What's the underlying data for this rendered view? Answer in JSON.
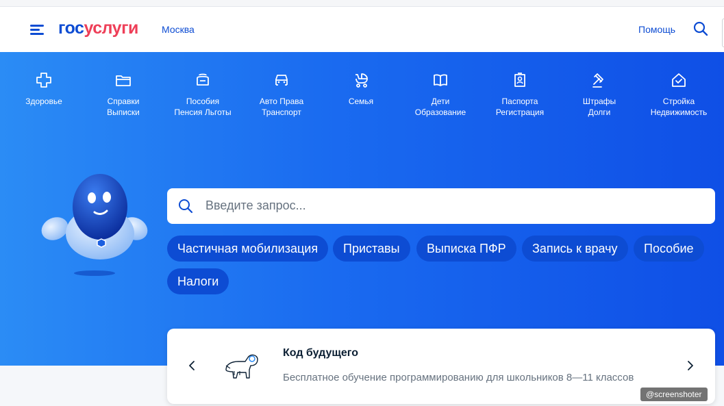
{
  "header": {
    "logo_part1": "гос",
    "logo_part2": "услуги",
    "city": "Москва",
    "help": "Помощь"
  },
  "categories": [
    {
      "line1": "Здоровье",
      "line2": "",
      "icon": "health-cross-icon"
    },
    {
      "line1": "Справки",
      "line2": "Выписки",
      "icon": "folder-icon"
    },
    {
      "line1": "Пособия",
      "line2": "Пенсия Льготы",
      "icon": "wallet-icon"
    },
    {
      "line1": "Авто Права",
      "line2": "Транспорт",
      "icon": "car-icon"
    },
    {
      "line1": "Семья",
      "line2": "",
      "icon": "stroller-icon"
    },
    {
      "line1": "Дети",
      "line2": "Образование",
      "icon": "book-icon"
    },
    {
      "line1": "Паспорта",
      "line2": "Регистрация",
      "icon": "passport-icon"
    },
    {
      "line1": "Штрафы",
      "line2": "Долги",
      "icon": "gavel-icon"
    },
    {
      "line1": "Стройка",
      "line2": "Недвижимость",
      "icon": "house-icon"
    }
  ],
  "search": {
    "placeholder": "Введите запрос..."
  },
  "chips": [
    "Частичная мобилизация",
    "Приставы",
    "Выписка ПФР",
    "Запись к врачу",
    "Пособие",
    "Налоги"
  ],
  "promo": {
    "title": "Код будущего",
    "description": "Бесплатное обучение программированию для школьников 8—11 классов"
  },
  "watermark": "@screenshoter",
  "colors": {
    "brand_blue": "#0d4cd3",
    "brand_red": "#ee3f58",
    "hero_bg": "#1a6bf0"
  }
}
